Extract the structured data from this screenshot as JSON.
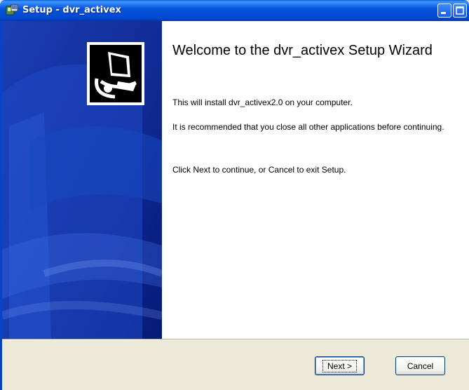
{
  "window": {
    "title": "Setup - dvr_activex"
  },
  "content": {
    "heading": "Welcome to the dvr_activex Setup Wizard",
    "paragraphs": [
      "This will install dvr_activex2.0 on your computer.",
      "It is recommended that you close all other applications before continuing.",
      "Click Next to continue, or Cancel to exit Setup."
    ]
  },
  "buttons": {
    "next": "Next >",
    "cancel": "Cancel"
  },
  "colors": {
    "titlebar": "#0055e5",
    "banner": "#0029a0",
    "content_bg": "#ffffff",
    "dialog_bg": "#ece9d8"
  },
  "icons": [
    "setup-app-icon",
    "minimize-icon",
    "maximize-icon",
    "close-icon",
    "installer-computer-icon"
  ]
}
